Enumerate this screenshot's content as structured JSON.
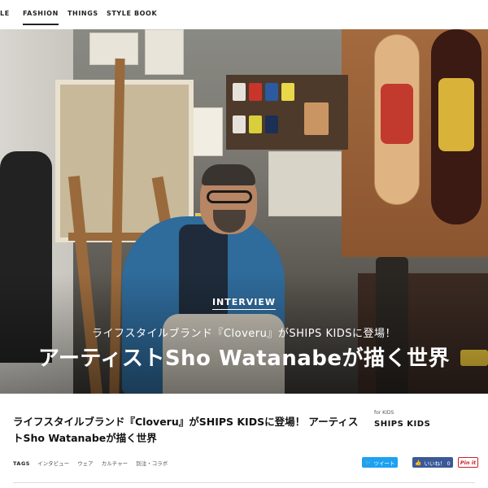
{
  "nav": {
    "items": [
      {
        "label": "LE",
        "active": false
      },
      {
        "label": "FASHION",
        "active": true
      },
      {
        "label": "THINGS",
        "active": false
      },
      {
        "label": "STYLE BOOK",
        "active": false
      }
    ]
  },
  "hero": {
    "tag": "INTERVIEW",
    "subtitle": "ライフスタイルブランド『Cloveru』がSHIPS KIDSに登場！",
    "title": "アーティストSho Watanabeが描く世界",
    "image_alt": "Artist Sho Watanabe in his studio"
  },
  "article": {
    "title": "ライフスタイルブランド『Cloveru』がSHIPS KIDSに登場！ アーティストSho Watanabeが描く世界",
    "brand_for": "for KIDS",
    "brand_name": "SHIPS KIDS",
    "tags_label": "TAGS",
    "tags": [
      "インタビュー",
      "ウェア",
      "カルチャー",
      "別注・コラボ"
    ]
  },
  "share": {
    "tweet": "ツイート",
    "like": "いいね！ 0",
    "pin": "Pin it"
  },
  "colors": {
    "twitter": "#1da1f2",
    "facebook": "#3b5998",
    "pinterest": "#cb2027"
  }
}
